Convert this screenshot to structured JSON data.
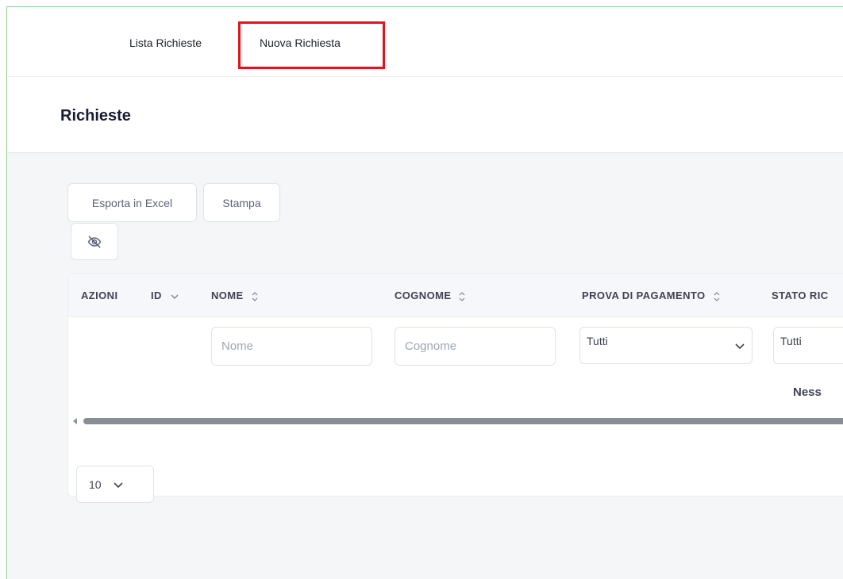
{
  "nav": {
    "lista_label": "Lista Richieste",
    "nuova_label": "Nuova Richiesta"
  },
  "page": {
    "title": "Richieste"
  },
  "toolbar": {
    "excel_label": "Esporta in Excel",
    "stampa_label": "Stampa",
    "visibility_icon": "eye-slash-icon"
  },
  "table": {
    "columns": [
      {
        "label": "AZIONI",
        "sort": ""
      },
      {
        "label": "ID",
        "sort": "chevron-down"
      },
      {
        "label": "NOME",
        "sort": "sort-updown"
      },
      {
        "label": "COGNOME",
        "sort": "sort-updown"
      },
      {
        "label": "PROVA DI PAGAMENTO",
        "sort": "sort-updown"
      },
      {
        "label": "STATO RIC",
        "sort": ""
      }
    ],
    "filters": {
      "nome_placeholder": "Nome",
      "cognome_placeholder": "Cognome",
      "prova_value": "Tutti",
      "stato_value": "Tutti"
    },
    "empty_message": "Ness"
  },
  "pagination": {
    "page_size": "10"
  },
  "colors": {
    "highlight": "#e3141d",
    "frame_border": "#8fd18f",
    "content_bg": "#f5f6f8"
  }
}
